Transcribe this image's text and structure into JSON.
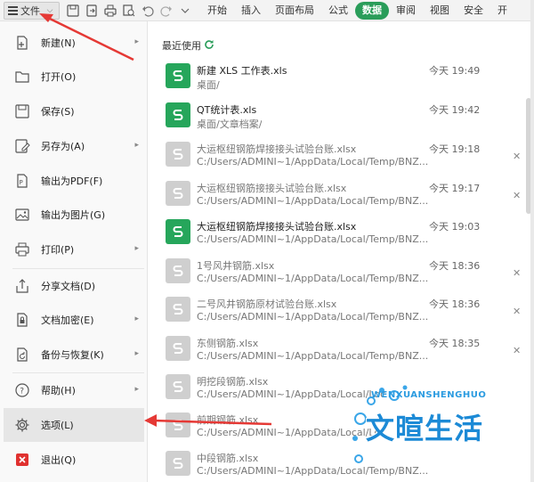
{
  "toolbar": {
    "file_label": "文件",
    "tabs": [
      "开始",
      "插入",
      "页面布局",
      "公式",
      "数据",
      "审阅",
      "视图",
      "安全",
      "开"
    ],
    "active_tab_index": 4
  },
  "menu": {
    "items": [
      {
        "label": "新建(N)",
        "icon": "new-file-icon",
        "submenu": true
      },
      {
        "label": "打开(O)",
        "icon": "folder-open-icon",
        "submenu": false
      },
      {
        "label": "保存(S)",
        "icon": "save-icon",
        "submenu": false
      },
      {
        "label": "另存为(A)",
        "icon": "save-as-icon",
        "submenu": true
      },
      {
        "label": "输出为PDF(F)",
        "icon": "pdf-icon",
        "submenu": false
      },
      {
        "label": "输出为图片(G)",
        "icon": "image-export-icon",
        "submenu": false
      },
      {
        "label": "打印(P)",
        "icon": "print-icon",
        "submenu": true
      },
      {
        "label": "分享文档(D)",
        "icon": "share-icon",
        "submenu": false
      },
      {
        "label": "文档加密(E)",
        "icon": "lock-icon",
        "submenu": true
      },
      {
        "label": "备份与恢复(K)",
        "icon": "backup-icon",
        "submenu": true
      },
      {
        "label": "帮助(H)",
        "icon": "help-icon",
        "submenu": true
      },
      {
        "label": "选项(L)",
        "icon": "gear-icon",
        "submenu": false
      },
      {
        "label": "退出(Q)",
        "icon": "exit-icon",
        "submenu": false
      }
    ]
  },
  "recent": {
    "title": "最近使用",
    "files": [
      {
        "name": "新建 XLS 工作表.xls",
        "path": "桌面/",
        "time": "今天 19:49",
        "active": true,
        "closable": false
      },
      {
        "name": "QT统计表.xls",
        "path": "桌面/文章档案/",
        "time": "今天 19:42",
        "active": true,
        "closable": false
      },
      {
        "name": "大运枢纽钢筋焊接接头试验台账.xlsx",
        "path": "C:/Users/ADMINI~1/AppData/Local/Temp/BNZ...",
        "time": "今天 19:18",
        "active": false,
        "closable": true
      },
      {
        "name": "大运枢纽钢筋接接头试验台账.xlsx",
        "path": "C:/Users/ADMINI~1/AppData/Local/Temp/BNZ...",
        "time": "今天 19:17",
        "active": false,
        "closable": true
      },
      {
        "name": "大运枢纽钢筋焊接接头试验台账.xlsx",
        "path": "C:/Users/ADMINI~1/AppData/Local/Temp/BNZ...",
        "time": "今天 19:03",
        "active": true,
        "closable": false
      },
      {
        "name": "1号风井钢筋.xlsx",
        "path": "C:/Users/ADMINI~1/AppData/Local/Temp/BNZ...",
        "time": "今天 18:36",
        "active": false,
        "closable": true
      },
      {
        "name": "二号风井钢筋原材试验台账.xlsx",
        "path": "C:/Users/ADMINI~1/AppData/Local/Temp/BNZ...",
        "time": "今天 18:36",
        "active": false,
        "closable": true
      },
      {
        "name": "东侧钢筋.xlsx",
        "path": "C:/Users/ADMINI~1/AppData/Local/Temp/BNZ...",
        "time": "今天 18:35",
        "active": false,
        "closable": true
      },
      {
        "name": "明挖段钢筋.xlsx",
        "path": "C:/Users/ADMINI~1/AppData/Local/Loc",
        "time": "",
        "active": false,
        "closable": false
      },
      {
        "name": "前期钢筋.xlsx",
        "path": "C:/Users/ADMINI~1/AppData/Local/Loc",
        "time": "",
        "active": false,
        "closable": false
      },
      {
        "name": "中段钢筋.xlsx",
        "path": "C:/Users/ADMINI~1/AppData/Local/Temp/BNZ...",
        "time": "",
        "active": false,
        "closable": false
      }
    ]
  },
  "watermark": {
    "small_text": "WENXUANSHENGHUO",
    "big_text": "文暄生活"
  },
  "colors": {
    "accent_green": "#2a9d5a",
    "annotation_red": "#e53935",
    "watermark_blue": "#1c8ad6"
  }
}
